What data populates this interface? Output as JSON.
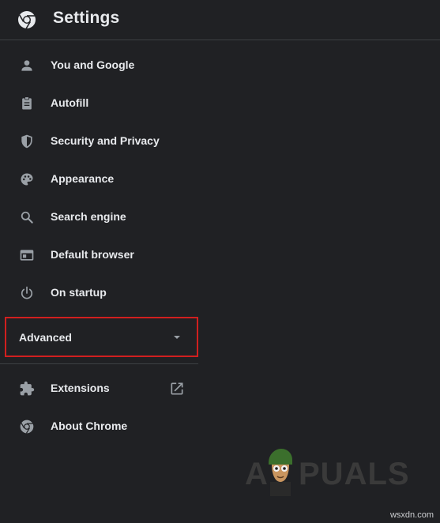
{
  "header": {
    "title": "Settings",
    "logo_icon": "chrome-logo-icon"
  },
  "sidebar": {
    "items": [
      {
        "label": "You and Google",
        "icon": "person-icon"
      },
      {
        "label": "Autofill",
        "icon": "clipboard-icon"
      },
      {
        "label": "Security and Privacy",
        "icon": "shield-icon"
      },
      {
        "label": "Appearance",
        "icon": "palette-icon"
      },
      {
        "label": "Search engine",
        "icon": "search-icon"
      },
      {
        "label": "Default browser",
        "icon": "browser-window-icon"
      },
      {
        "label": "On startup",
        "icon": "power-icon"
      }
    ],
    "advanced": {
      "label": "Advanced",
      "icon": "caret-down-icon",
      "highlight_color": "#d11f1f"
    },
    "bottom_items": [
      {
        "label": "Extensions",
        "icon": "puzzle-icon",
        "trailing_icon": "open-in-new-icon"
      },
      {
        "label": "About Chrome",
        "icon": "chrome-logo-icon"
      }
    ]
  },
  "watermark": {
    "text_left": "A",
    "text_right": "PUALS",
    "site": "wsxdn.com"
  },
  "colors": {
    "background": "#202124",
    "text": "#e8eaed",
    "icon": "#9aa0a6",
    "divider": "#3c4043"
  }
}
